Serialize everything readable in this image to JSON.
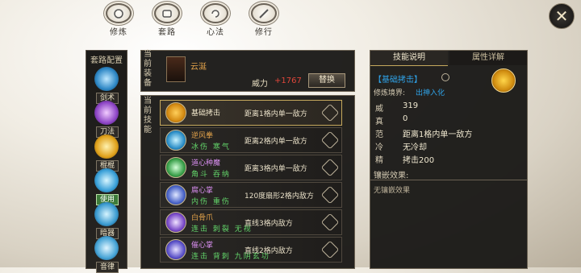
{
  "topnav": [
    {
      "label": "修炼"
    },
    {
      "label": "套路"
    },
    {
      "label": "心法"
    },
    {
      "label": "修行"
    }
  ],
  "close_icon": "✕",
  "left": {
    "title": "套路配置",
    "slots": [
      {
        "label": "剑术"
      },
      {
        "label": "刀法"
      },
      {
        "label": "棍棍"
      },
      {
        "label": "使用中"
      },
      {
        "label": "暗器"
      },
      {
        "label": "音律"
      }
    ]
  },
  "equip": {
    "label": "当前装备",
    "name": "云涎",
    "power_label": "威力",
    "power_value": "+1767",
    "replace": "替换"
  },
  "skills": {
    "label": "当前技能",
    "rows": [
      {
        "name": "基础拷击",
        "range": "距离1格内单一敌方",
        "tags": ""
      },
      {
        "name": "逆风拳",
        "range": "距离2格内单一敌方",
        "tags": "冰伤 寒气"
      },
      {
        "name": "道心种魔",
        "range": "距离3格内单一敌方",
        "tags": "角斗 吞纳"
      },
      {
        "name": "腐心掌",
        "range": "120度扇形2格内敌方",
        "tags": "内伤 重伤"
      },
      {
        "name": "白骨爪",
        "range": "直线3格内敌方",
        "tags": "连击 刺裂 无视"
      },
      {
        "name": "催心掌",
        "range": "直线2格内敌方",
        "tags": "连击 背刺 九阴玄功"
      }
    ]
  },
  "detail": {
    "tab1": "技能说明",
    "tab2": "属性详解",
    "name": "【基础拷击】",
    "realm_label": "修炼境界:",
    "realm_value": "出神入化",
    "stats": [
      {
        "k": "威",
        "v": "319"
      },
      {
        "k": "真",
        "v": "0"
      },
      {
        "k": "范",
        "v": "距离1格内单一敌方"
      },
      {
        "k": "冷",
        "v": "无冷却"
      },
      {
        "k": "精",
        "v": "拷击200"
      }
    ],
    "inlay_label": "镶嵌效果:",
    "inlay_value": "无镶嵌效果"
  },
  "colors": {
    "accent": "#2fa3e8",
    "power": "#e0463a",
    "name_orange": "#e2a24a",
    "tag_green": "#63d56a"
  }
}
